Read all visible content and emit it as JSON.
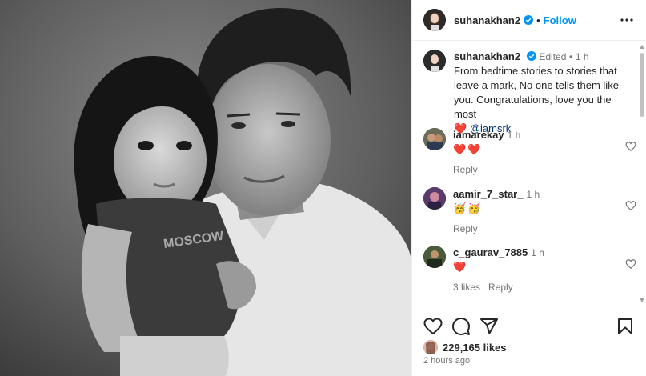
{
  "post": {
    "username": "suhanakhan2",
    "follow_label": "Follow",
    "dot": "•",
    "caption": {
      "username": "suhanakhan2",
      "edited": "Edited",
      "dot": "•",
      "time": "1 h",
      "text": "From bedtime stories to stories that leave a mark, No one tells them like you. Congratulations, love you the most",
      "heart": "❤️",
      "mention": "@iamsrk"
    }
  },
  "comments": [
    {
      "username": "iamarekay",
      "time": "1 h",
      "text": "❤️❤️",
      "actions": [
        "Reply"
      ]
    },
    {
      "username": "aamir_7_star_",
      "time": "1 h",
      "text": "🥳🥳",
      "actions": [
        "Reply"
      ]
    },
    {
      "username": "c_gaurav_7885",
      "time": "1 h",
      "text": "❤️",
      "actions": [
        "3 likes",
        "Reply"
      ]
    }
  ],
  "footer": {
    "likes": "229,165 likes",
    "time_ago": "2 hours ago"
  },
  "icons": {
    "like": "heart-outline-icon",
    "comment": "speech-bubble-icon",
    "share": "paper-plane-icon",
    "save": "bookmark-icon",
    "more": "more-dots-icon",
    "verified": "verified-badge-icon"
  },
  "colors": {
    "accent": "#0095f6",
    "verified": "#0095f6",
    "mention": "#00376b",
    "heart": "#ed1c24",
    "muted": "#737373"
  }
}
